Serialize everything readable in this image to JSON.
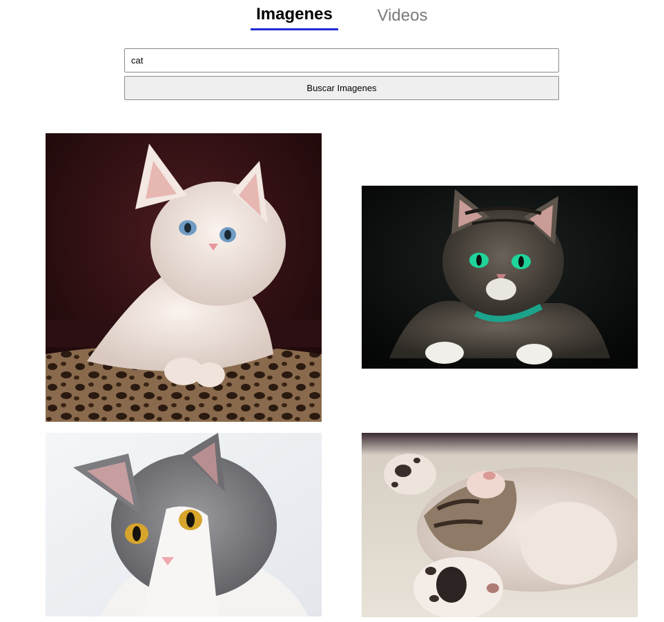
{
  "tabs": {
    "images_label": "Imagenes",
    "videos_label": "Videos",
    "active": "images"
  },
  "search": {
    "value": "cat",
    "button_label": "Buscar Imagenes"
  },
  "colors": {
    "tab_underline": "#1f2cd0",
    "inactive_tab_text": "#7a7a7a",
    "button_bg": "#efefef"
  },
  "results": [
    {
      "subject": "white kitten with blue eyes resting on leopard-print cushion"
    },
    {
      "subject": "tabby cat with green eyes and teal collar on dark background"
    },
    {
      "subject": "grey and white cat with amber eyes on white background"
    },
    {
      "subject": "kitten lying on its back showing paws"
    }
  ]
}
